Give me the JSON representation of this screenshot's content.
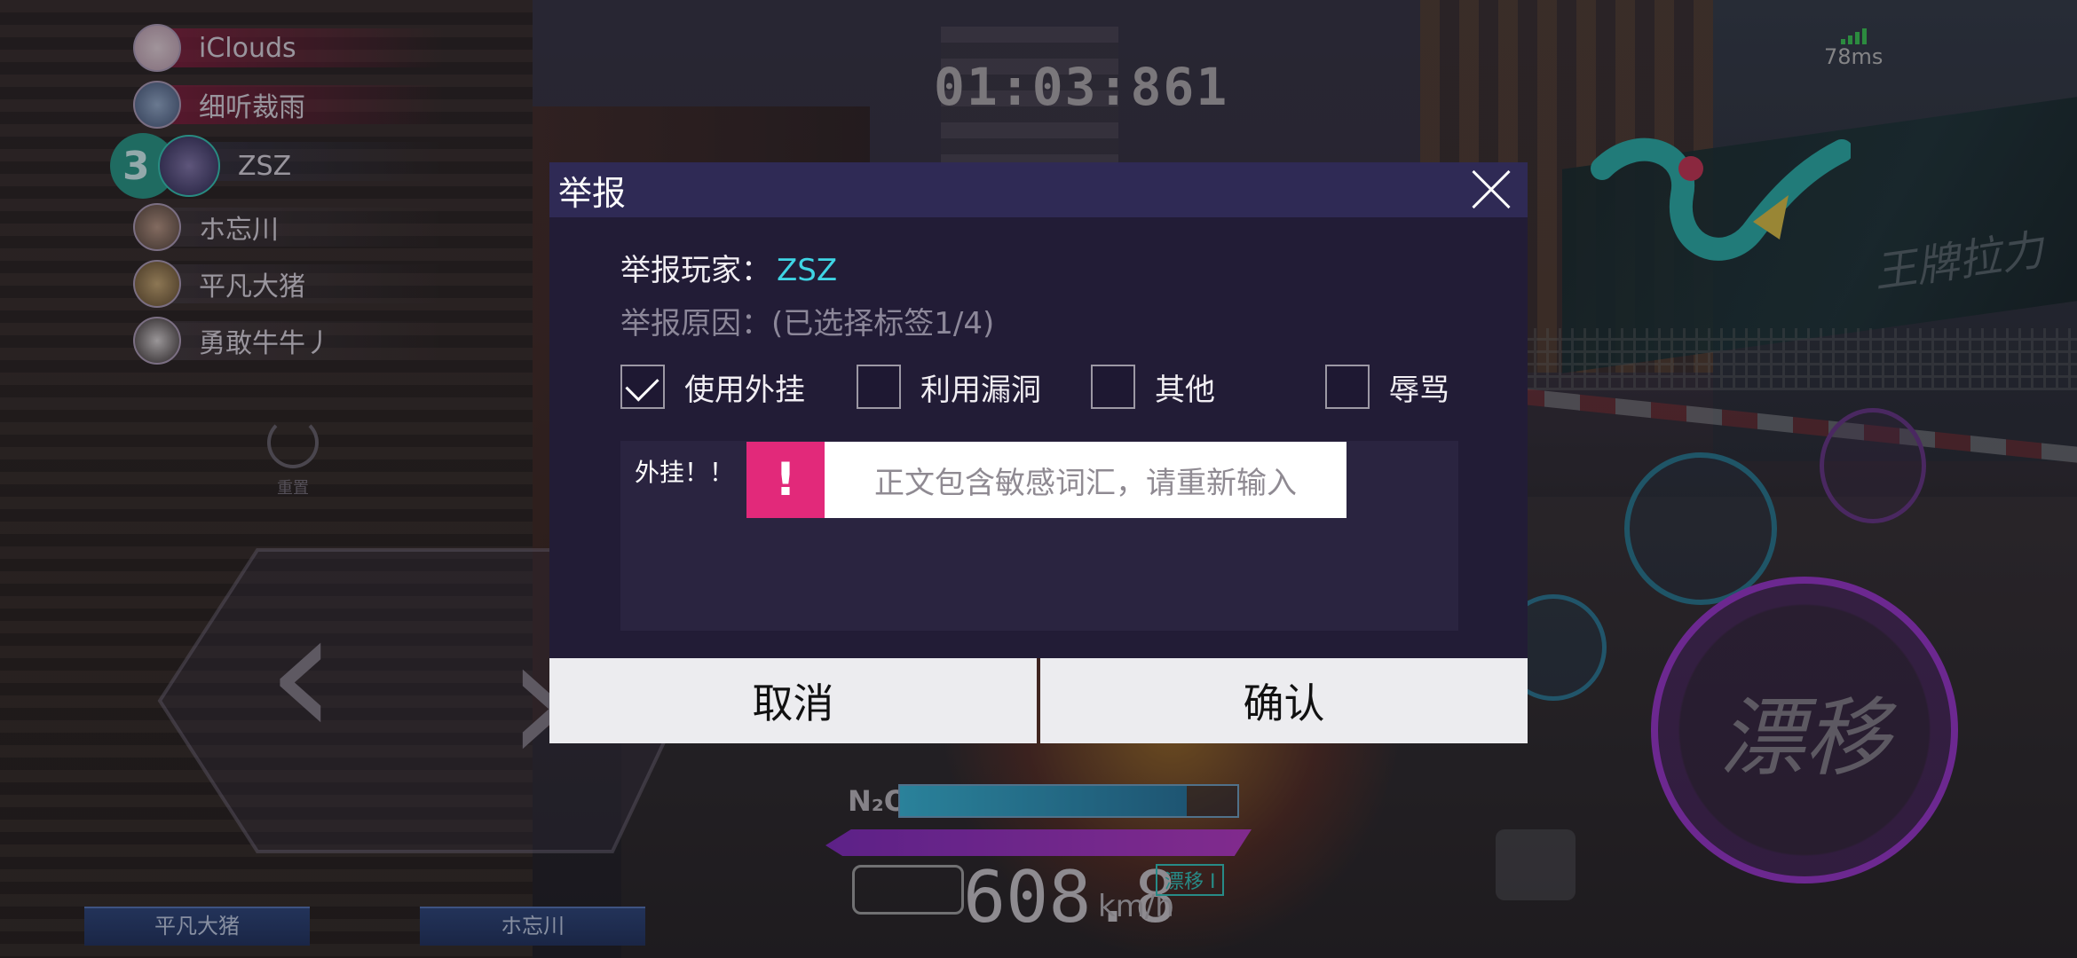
{
  "race": {
    "timer": "01:03:861",
    "ping": "78ms",
    "speed": "608.8",
    "speed_unit": "km/h",
    "nitro_label": "N₂O",
    "nitro_level": 0.85,
    "drift_tag": "漂移 I",
    "brand_text": "王牌拉力"
  },
  "leaderboard": [
    {
      "name": "iClouds"
    },
    {
      "name": "细听裁雨"
    },
    {
      "rank": "3",
      "name": "ZSZ",
      "current": true
    },
    {
      "name": "ホ忘川"
    },
    {
      "name": "平凡大猪"
    },
    {
      "name": "勇敢牛牛丿"
    }
  ],
  "controls": {
    "reset_label": "重置",
    "left_arrow": "‹",
    "right_arrow": "›",
    "drift_button": "漂移"
  },
  "bottom_tags": [
    "平凡大猪",
    "ホ忘川"
  ],
  "dialog": {
    "title": "举报",
    "player_label": "举报玩家：",
    "player_name": "ZSZ",
    "reason_label": "举报原因：(已选择标签1/4)",
    "tags": [
      {
        "label": "使用外挂",
        "checked": true
      },
      {
        "label": "利用漏洞",
        "checked": false
      },
      {
        "label": "其他",
        "checked": false
      },
      {
        "label": "辱骂",
        "checked": false
      }
    ],
    "input_value": "外挂！！",
    "warning_mark": "!",
    "warning_text": "正文包含敏感词汇，请重新输入",
    "cancel_label": "取消",
    "confirm_label": "确认"
  },
  "colors": {
    "dialog_header": "#2f2a55",
    "dialog_body": "#221c36",
    "player_name": "#3fd4e4",
    "warning": "#e2297a",
    "drift_ring": "#a23ad6",
    "rank_badge": "#2ba08e"
  }
}
